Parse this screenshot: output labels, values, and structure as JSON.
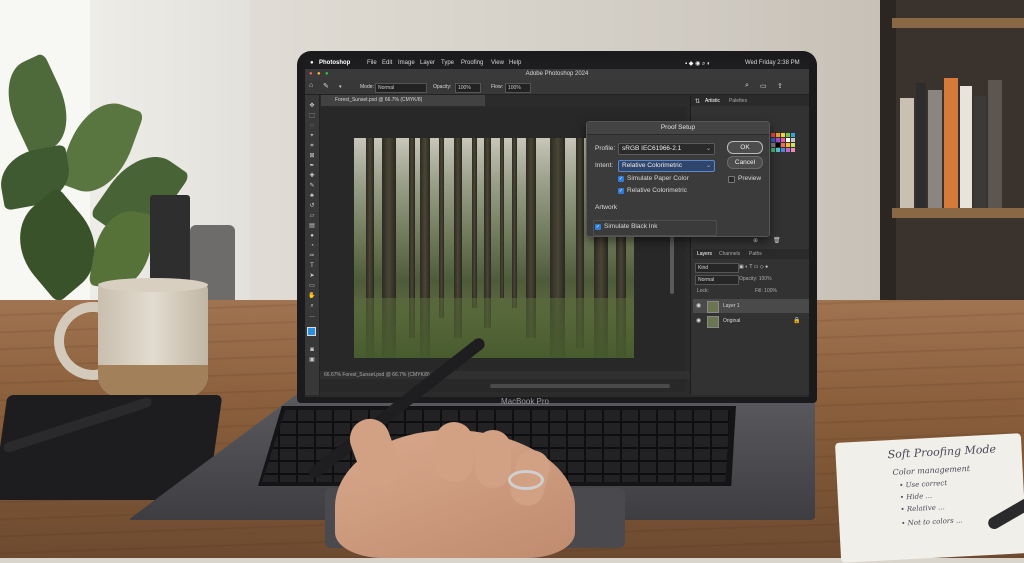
{
  "menubar": {
    "app_name": "Photoshop",
    "items": [
      "File",
      "Edit",
      "Image",
      "Layer",
      "Type",
      "Select",
      "Filter",
      "3D",
      "View",
      "Proofing",
      "View",
      "Help"
    ],
    "clock": "Wed Friday  2:38 PM"
  },
  "window_title": "Adobe Photoshop 2024",
  "options_bar": {
    "mode_label": "Mode:",
    "mode_value": "Normal",
    "opacity_label": "Opacity:",
    "opacity_value": "100%",
    "flow_label": "Flow:",
    "flow_value": "100%"
  },
  "document_tab": "Forest_Sunset.psd @ 66.7% (CMYK/8)",
  "status_bar": "66.67%     Forest_Sunset.psd @ 66.7% (CMYK/8)",
  "panels": {
    "top_tabs": [
      "Artistic",
      "Palettes"
    ],
    "bottom_tabs": [
      "Layers",
      "Channels",
      "Paths"
    ],
    "layer_kind": "Kind",
    "layer_mode": "Normal",
    "layer_opacity": "Opacity: 100%",
    "layer_lock": "Lock:",
    "layer_fill": "Fill: 100%",
    "layers": [
      {
        "name": "Layer 1"
      },
      {
        "name": "Original"
      }
    ]
  },
  "swatch_colors": [
    "#e8463c",
    "#f39a2b",
    "#f6d12f",
    "#7cc04b",
    "#2fa6d9",
    "#3f5bc4",
    "#9b4fc3",
    "#e65aa3",
    "#ffffff",
    "#c9c9c9",
    "#7f7f7f",
    "#000000",
    "#f26b4f",
    "#f5b640",
    "#d8e04a",
    "#47b56f",
    "#4dc3c9",
    "#5b7fd8",
    "#b86ac7",
    "#f08cb8"
  ],
  "dialog": {
    "title": "Proof Setup",
    "profile_label": "Profile:",
    "profile_value": "sRGB IEC61966-2.1",
    "intent_label": "Intent:",
    "intent_value": "Relative Colorimetric",
    "checks": [
      {
        "label": "Simulate Paper Color",
        "checked": true
      },
      {
        "label": "Relative Colorimetric",
        "checked": true
      }
    ],
    "artwork_label": "Artwork",
    "black_ink_label": "Simulate Black Ink",
    "ok_label": "OK",
    "cancel_label": "Cancel",
    "preview_label": "Preview"
  },
  "laptop_brand": "MacBook Pro",
  "notebook": {
    "title": "Soft Proofing Mode",
    "lines": [
      "Color management",
      "• Use correct",
      "• Hide ...",
      "• Relative ...",
      "• Not to colors ..."
    ]
  }
}
